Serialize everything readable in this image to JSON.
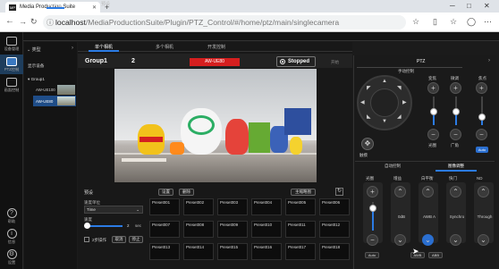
{
  "browser": {
    "tab_title": "Media Production Suite",
    "favicon_text": "MP",
    "url_host": "localhost",
    "url_path": "/MediaProductionSuite/Plugin/PTZ_Control/#/home/ptz/main/singlecamera"
  },
  "sidebar": {
    "items": [
      {
        "label": "设备管理",
        "icon": "device-icon"
      },
      {
        "label": "PTZ控制",
        "icon": "camera-icon"
      },
      {
        "label": "画面控制",
        "icon": "monitor-icon"
      },
      {
        "label": "帮助",
        "icon": "help-icon"
      },
      {
        "label": "信息",
        "icon": "info-icon"
      },
      {
        "label": "设置",
        "icon": "settings-icon"
      }
    ]
  },
  "top_tabs": [
    "主画面",
    "预设"
  ],
  "left_panel": {
    "type_label": "类型",
    "display_label": "显示设备",
    "group": "Group1",
    "devices": [
      "AW-UE100",
      "AW-UE80"
    ]
  },
  "sub_tabs": [
    "单个相机",
    "多个相机",
    "开发控制"
  ],
  "camera": {
    "group": "Group1",
    "number": "2",
    "model": "AW-UE80",
    "status": "Stopped",
    "extra": "开始"
  },
  "preset": {
    "title": "预设",
    "speed_unit_label": "速度单位",
    "speed_unit_value": "Time",
    "speed_label": "速度",
    "speed_value": "2",
    "speed_unit": "sec",
    "checkbox_label": "2步操作",
    "cancel_label": "取消",
    "stop_label": "停止",
    "set_label": "设置",
    "delete_label": "删除",
    "thumb_label": "主缩略图",
    "presets": [
      "Preset001",
      "Preset002",
      "Preset003",
      "Preset004",
      "Preset005",
      "Preset006",
      "Preset007",
      "Preset008",
      "Preset009",
      "Preset010",
      "Preset011",
      "Preset012",
      "Preset013",
      "Preset014",
      "Preset015",
      "Preset016",
      "Preset017",
      "Preset018"
    ]
  },
  "ptz": {
    "title": "PTZ",
    "manual_label": "手动控制",
    "zoom_label": "变焦",
    "focus_label": "焦点",
    "fine_label": "微调",
    "iris_label": "光圈",
    "tele_label": "广角",
    "auto_label": "Auto",
    "auto_ctrl_label": "自动控制",
    "image_adjust_label": "图像调整",
    "touch_label": "触摸"
  },
  "image_adjust": {
    "columns": [
      "光圈",
      "增益",
      "白平衡",
      "快门",
      "ND"
    ],
    "values": [
      "",
      "0dB",
      "AWB A",
      "Synchro",
      "Through"
    ],
    "auto_label": "Auto",
    "awb_label": "AWB",
    "abb_label": "ABB"
  }
}
